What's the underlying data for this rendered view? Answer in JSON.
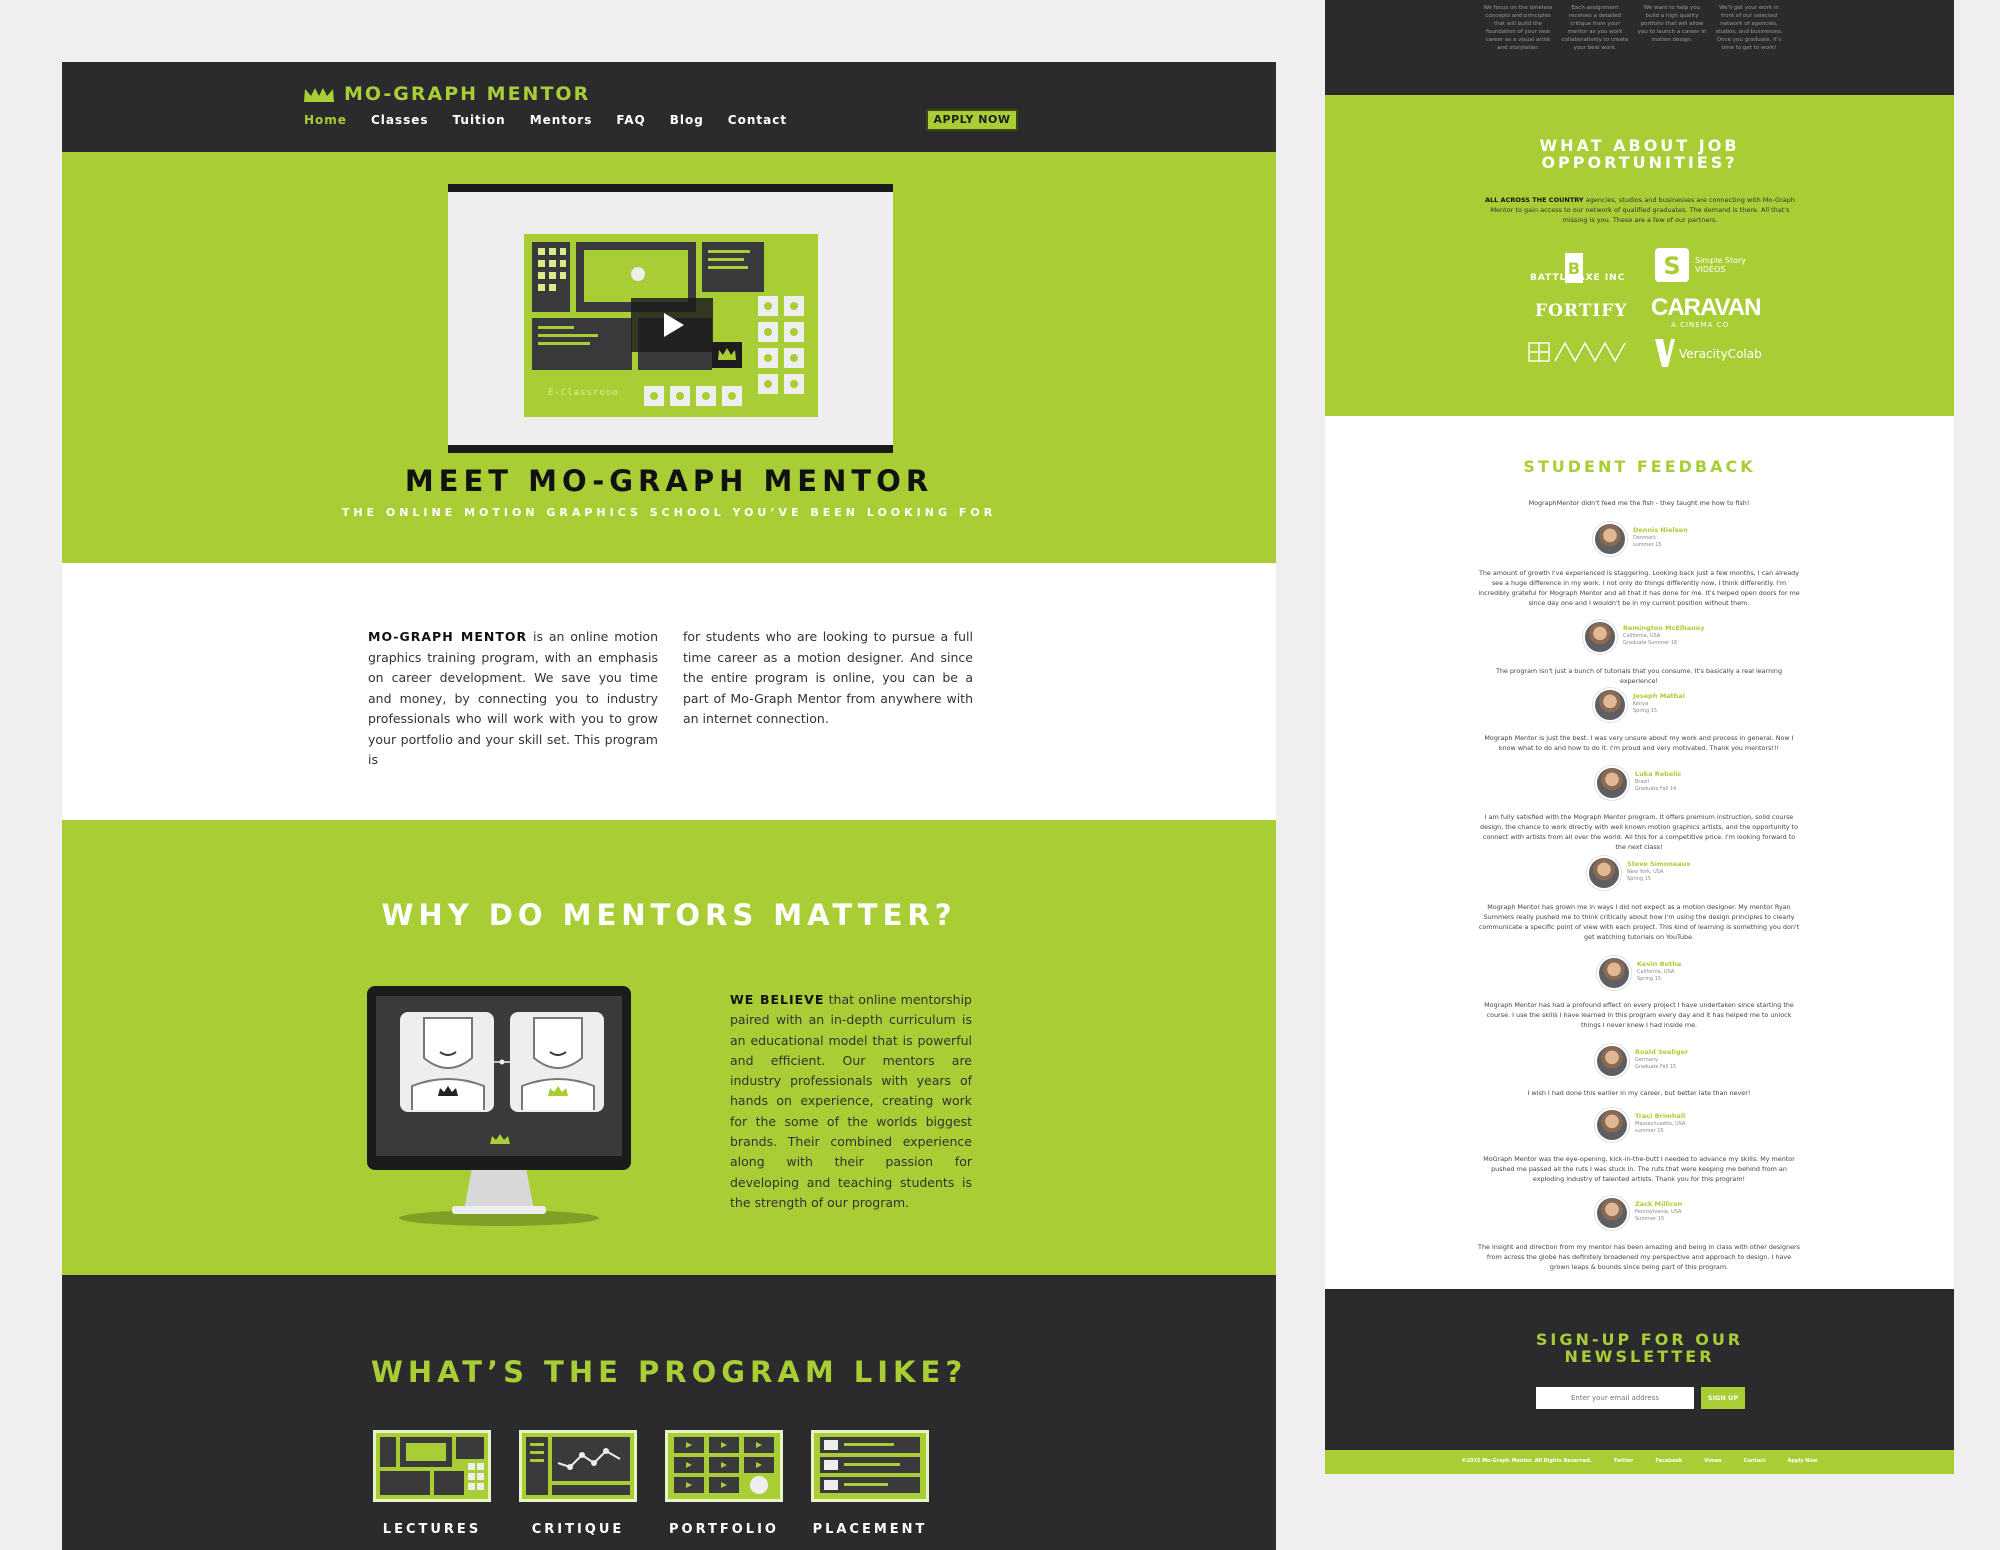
{
  "brand": {
    "name": "MO-GRAPH MENTOR",
    "accent_color": "#a9ce35",
    "dark_color": "#2b2b2d"
  },
  "nav": {
    "items": [
      "Home",
      "Classes",
      "Tuition",
      "Mentors",
      "FAQ",
      "Blog",
      "Contact"
    ],
    "active": "Home",
    "apply_label": "APPLY NOW"
  },
  "hero": {
    "video_label": "E-Classroom",
    "title": "MEET MO-GRAPH MENTOR",
    "subtitle": "THE ONLINE MOTION GRAPHICS SCHOOL YOU’VE BEEN LOOKING FOR"
  },
  "intro": {
    "brand_inline": "MO-GRAPH MENTOR",
    "col1": "is an online motion graphics training program, with an emphasis on career development. We save you time and money, by connecting you to industry professionals who will work with you to grow your portfolio and your skill set. This program is",
    "col2": "for students who are looking to pursue a full time career as a motion designer. And since the entire program is online, you can be a part of Mo-Graph Mentor from anywhere with an internet connection."
  },
  "why": {
    "title": "WHY DO MENTORS MATTER?",
    "lead": "WE BELIEVE",
    "body": "that online mentorship paired with an in-depth curriculum is an educational model that is powerful and efficient. Our mentors are industry professionals with years of hands on experience, creating work for the some of the worlds biggest brands. Their combined experience along with their passion for developing and teaching students is the strength of our program."
  },
  "program": {
    "title": "WHAT’S THE PROGRAM LIKE?",
    "items": [
      "LECTURES",
      "CRITIQUE",
      "PORTFOLIO",
      "PLACEMENT"
    ]
  },
  "right_top": {
    "cols": [
      "We focus on the timeless concepts and principles that will build the foundation of your new career as a visual artist and storyteller.",
      "Each assignment receives a detailed critique from your mentor as you work collaboratively to create your best work.",
      "We want to help you build a high quality portfolio that will allow you to launch a career in motion design.",
      "We'll get your work in front of our selected network of agencies, studios, and businesses. Once you graduate, it's time to get to work!"
    ]
  },
  "jobs": {
    "title": "WHAT ABOUT JOB OPPORTUNITIES?",
    "lead": "ALL ACROSS THE COUNTRY",
    "body": "agencies, studios and businesses are connecting with Mo-Graph Mentor to gain access to our network of qualified graduates. The demand is there. All that's missing is you. These are a few of our partners.",
    "partners": [
      "BATTLE AXE INC",
      "Simple Story VIDEOS",
      "FORTIFY",
      "CARAVAN",
      "A CINEMA CO",
      "VeracityColab"
    ]
  },
  "feedback": {
    "title": "STUDENT FEEDBACK",
    "opening": "MographMentor didn't feed me the fish - they taught me how to fish!",
    "entries": [
      {
        "name": "Dennis Nielsen",
        "location": "Denmark",
        "term": "summer 15",
        "quote": "The amount of growth I've experienced is staggering. Looking back just a few months, I can already see a huge difference in my work. I not only do things differently now, I think differently. I'm incredibly grateful for Mograph Mentor and all that it has done for me. It's helped open doors for me since day one and I wouldn't be in my current position without them."
      },
      {
        "name": "Remington McElhaney",
        "location": "California, USA",
        "term": "Graduate Summer 16",
        "quote": "The program isn't just a bunch of tutorials that you consume. It's basically a real learning experience!"
      },
      {
        "name": "Joseph Mathai",
        "location": "Kenya",
        "term": "Spring 15",
        "quote": "Mograph Mentor is just the best. I was very unsure about my work and process in general. Now I know what to do and how to do it. I'm proud and very motivated. Thank you mentors!!!"
      },
      {
        "name": "Luka Rebelic",
        "location": "Brazil",
        "term": "Graduate Fall 14",
        "quote": "I am fully satisfied with the Mograph Mentor program. It offers premium instruction, solid course design, the chance to work directly with well known motion graphics artists, and the opportunity to connect with artists from all over the world. All this for a competitive price. I'm looking forward to the next class!"
      },
      {
        "name": "Steve Simoneaux",
        "location": "New York, USA",
        "term": "Spring 15",
        "quote": "Mograph Mentor has grown me in ways I did not expect as a motion designer. My mentor Ryan Summers really pushed me to think critically about how I'm using the design principles to clearly communicate a specific point of view with each project. This kind of learning is something you don't get watching tutorials on YouTube."
      },
      {
        "name": "Kevin Botha",
        "location": "California, USA",
        "term": "Spring 15",
        "quote": "Mograph Mentor has had a profound effect on every project I have undertaken since starting the course. I use the skills I have learned in this program every day and it has helped me to unlock things I never knew I had inside me."
      },
      {
        "name": "Roald Seeliger",
        "location": "Germany",
        "term": "Graduate Fall 15",
        "quote": "I wish I had done this earlier in my career, but better late than never!"
      },
      {
        "name": "Traci Brimhall",
        "location": "Massachusetts, USA",
        "term": "summer 15",
        "quote": "MoGraph Mentor was the eye-opening, kick-in-the-butt I needed to advance my skills. My mentor pushed me passed all the ruts I was stuck in. The ruts that were keeping me behind from an exploding industry of talented artists. Thank you for this program!"
      },
      {
        "name": "Zack Milliron",
        "location": "Pennsylvania, USA",
        "term": "Summer 15",
        "quote": "The insight and direction from my mentor has been amazing and being in class with other designers from across the globe has definitely broadened my perspective and approach to design. I have grown leaps & bounds since being part of this program."
      }
    ]
  },
  "newsletter": {
    "title": "SIGN-UP FOR OUR NEWSLETTER",
    "placeholder": "Enter your email address",
    "button": "SIGN UP"
  },
  "footer": {
    "copyright": "©2015 Mo-Graph Mentor. All Rights Reserved.",
    "links": [
      "Twitter",
      "Facebook",
      "Vimeo",
      "Contact",
      "Apply Now"
    ]
  }
}
